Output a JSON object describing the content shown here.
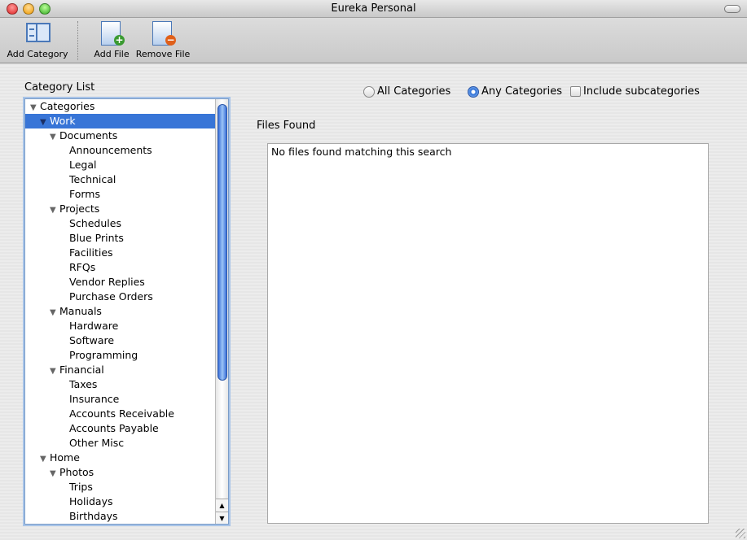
{
  "window": {
    "title": "Eureka Personal"
  },
  "toolbar": {
    "add_category": "Add Category",
    "add_file": "Add File",
    "remove_file": "Remove File"
  },
  "category_list": {
    "label": "Category List",
    "items": [
      {
        "label": "Categories",
        "level": 0,
        "expanded": true
      },
      {
        "label": "Work",
        "level": 1,
        "expanded": true,
        "selected": true
      },
      {
        "label": "Documents",
        "level": 2,
        "expanded": true
      },
      {
        "label": "Announcements",
        "level": 3
      },
      {
        "label": "Legal",
        "level": 3
      },
      {
        "label": "Technical",
        "level": 3
      },
      {
        "label": "Forms",
        "level": 3
      },
      {
        "label": "Projects",
        "level": 2,
        "expanded": true
      },
      {
        "label": "Schedules",
        "level": 3
      },
      {
        "label": "Blue Prints",
        "level": 3
      },
      {
        "label": "Facilities",
        "level": 3
      },
      {
        "label": "RFQs",
        "level": 3
      },
      {
        "label": "Vendor Replies",
        "level": 3
      },
      {
        "label": "Purchase Orders",
        "level": 3
      },
      {
        "label": "Manuals",
        "level": 2,
        "expanded": true
      },
      {
        "label": "Hardware",
        "level": 3
      },
      {
        "label": "Software",
        "level": 3
      },
      {
        "label": "Programming",
        "level": 3
      },
      {
        "label": "Financial",
        "level": 2,
        "expanded": true
      },
      {
        "label": "Taxes",
        "level": 3
      },
      {
        "label": "Insurance",
        "level": 3
      },
      {
        "label": "Accounts Receivable",
        "level": 3
      },
      {
        "label": "Accounts Payable",
        "level": 3
      },
      {
        "label": "Other Misc",
        "level": 3
      },
      {
        "label": "Home",
        "level": 1,
        "expanded": true
      },
      {
        "label": "Photos",
        "level": 2,
        "expanded": true
      },
      {
        "label": "Trips",
        "level": 3
      },
      {
        "label": "Holidays",
        "level": 3
      },
      {
        "label": "Birthdays",
        "level": 3
      }
    ]
  },
  "options": {
    "all_categories": "All Categories",
    "any_categories": "Any Categories",
    "include_subcategories": "Include subcategories",
    "selected": "any",
    "include_checked": false
  },
  "files": {
    "label": "Files Found",
    "empty_message": "No files found matching this search"
  }
}
